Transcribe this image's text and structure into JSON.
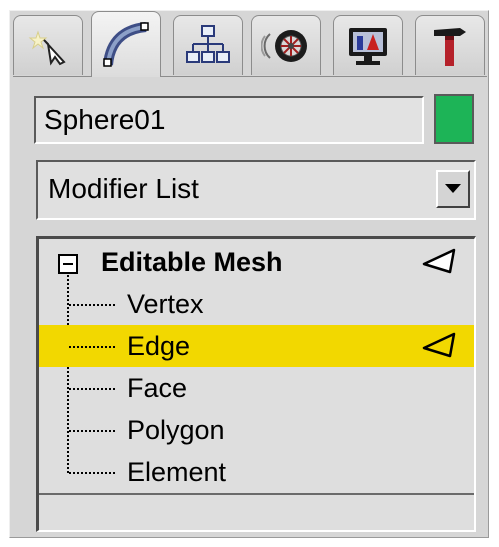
{
  "command_panel": {
    "tabs": [
      {
        "name": "Create",
        "icon": "create-icon",
        "active": false
      },
      {
        "name": "Modify",
        "icon": "modify-icon",
        "active": true
      },
      {
        "name": "Hierarchy",
        "icon": "hierarchy-icon",
        "active": false
      },
      {
        "name": "Motion",
        "icon": "motion-icon",
        "active": false
      },
      {
        "name": "Display",
        "icon": "display-icon",
        "active": false
      },
      {
        "name": "Utilities",
        "icon": "utilities-icon",
        "active": false
      }
    ],
    "object_name": "Sphere01",
    "object_color": "#1db457",
    "modifier_list_label": "Modifier List",
    "stack": {
      "root": "Editable Mesh",
      "subobjects": [
        "Vertex",
        "Edge",
        "Face",
        "Polygon",
        "Element"
      ],
      "selected": "Edge",
      "selection_color": "#f2d800"
    }
  }
}
